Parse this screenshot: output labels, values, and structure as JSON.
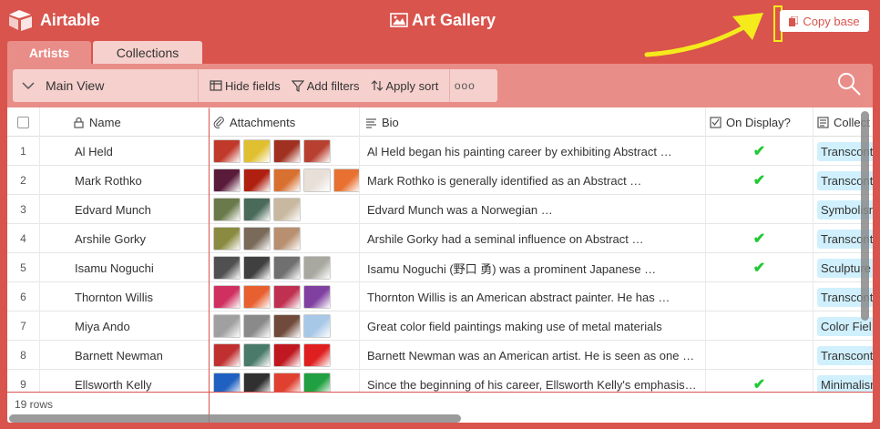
{
  "app": {
    "brand": "Airtable",
    "base_title": "Art Gallery",
    "copy_label": "Copy base"
  },
  "tabs": [
    {
      "label": "Artists",
      "active": true
    },
    {
      "label": "Collections",
      "active": false
    }
  ],
  "toolbar": {
    "view_name": "Main View",
    "hide_fields": "Hide fields",
    "add_filters": "Add filters",
    "apply_sort": "Apply sort",
    "more": "ooo"
  },
  "columns": {
    "name": "Name",
    "attachments": "Attachments",
    "bio": "Bio",
    "on_display": "On Display?",
    "collection": "Collect"
  },
  "rows": [
    {
      "num": "1",
      "name": "Al Held",
      "bio": "Al Held began his painting career by exhibiting Abstract …",
      "on_display": true,
      "collection": "Transcont",
      "thumbs": [
        "#c0392b",
        "#e0c030",
        "#a03020",
        "#b84030"
      ]
    },
    {
      "num": "2",
      "name": "Mark Rothko",
      "bio": "Mark Rothko is generally identified as an Abstract …",
      "on_display": true,
      "collection": "Transcont",
      "thumbs": [
        "#5a1a3a",
        "#b02010",
        "#d87030",
        "#e8e0d8",
        "#e87030"
      ]
    },
    {
      "num": "3",
      "name": "Edvard Munch",
      "bio": "Edvard Munch was a Norwegian …",
      "on_display": false,
      "collection": "Symbolisn",
      "thumbs": [
        "#6a7a4a",
        "#4a6a5a",
        "#c8b8a0"
      ]
    },
    {
      "num": "4",
      "name": "Arshile Gorky",
      "bio": "Arshile Gorky had a seminal influence on Abstract …",
      "on_display": true,
      "collection": "Transcont",
      "thumbs": [
        "#8a8a40",
        "#7a6a5a",
        "#b89070"
      ]
    },
    {
      "num": "5",
      "name": "Isamu Noguchi",
      "bio": "Isamu Noguchi (野口 勇) was a prominent Japanese …",
      "on_display": true,
      "collection": "Sculpture",
      "thumbs": [
        "#505050",
        "#404040",
        "#707070",
        "#a8a8a0"
      ]
    },
    {
      "num": "6",
      "name": "Thornton Willis",
      "bio": "Thornton Willis is an American abstract painter. He has …",
      "on_display": false,
      "collection": "Transcont",
      "thumbs": [
        "#d03060",
        "#e86030",
        "#c03050",
        "#8040a0"
      ]
    },
    {
      "num": "7",
      "name": "Miya Ando",
      "bio": "Great color field paintings making use of metal materials",
      "on_display": false,
      "collection": "Color Fiel",
      "thumbs": [
        "#a0a0a0",
        "#8a8a8a",
        "#704a3a",
        "#a8c8e8"
      ]
    },
    {
      "num": "8",
      "name": "Barnett Newman",
      "bio": "Barnett Newman was an American artist. He is seen as one …",
      "on_display": false,
      "collection": "Transcont",
      "thumbs": [
        "#c03030",
        "#4a7a6a",
        "#c01820",
        "#e02020"
      ]
    },
    {
      "num": "9",
      "name": "Ellsworth Kelly",
      "bio": "Since the beginning of his career, Ellsworth Kelly's emphasis…",
      "on_display": true,
      "collection": "Minimalisr",
      "thumbs": [
        "#2060c0",
        "#303030",
        "#e04030",
        "#20a040"
      ]
    }
  ],
  "footer": {
    "row_count": "19 rows"
  },
  "colors": {
    "brand": "#d9544d",
    "tab_active": "#e98d88",
    "tab_inactive": "#f6d0cd",
    "check": "#20c933",
    "pill": "#d0f0fd",
    "annotation": "#f5ea1c"
  }
}
